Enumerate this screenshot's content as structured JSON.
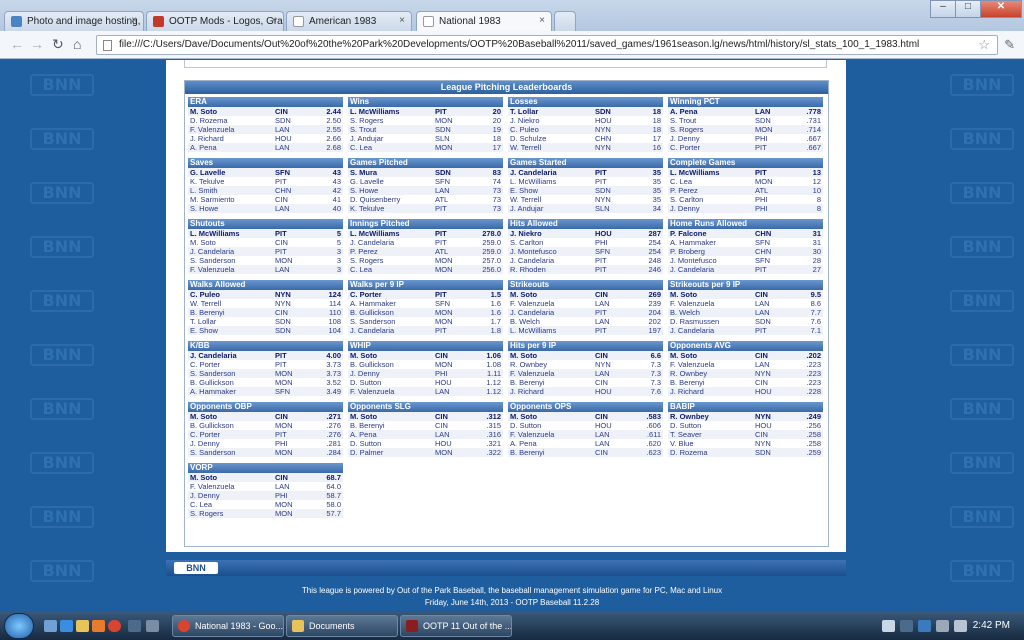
{
  "browser": {
    "tabs": [
      {
        "label": "Photo and image hosting,",
        "active": false
      },
      {
        "label": "OOTP Mods - Logos, Grap",
        "active": false
      },
      {
        "label": "American 1983",
        "active": false
      },
      {
        "label": "National 1983",
        "active": true
      }
    ],
    "url": "file:///C:/Users/Dave/Documents/Out%20of%20the%20Park%20Developments/OOTP%20Baseball%2011/saved_games/1961season.lg/news/html/history/sl_stats_100_1_1983.html",
    "back_icon": "back-arrow-icon",
    "forward_icon": "forward-arrow-icon",
    "reload_icon": "reload-icon",
    "home_icon": "home-icon"
  },
  "page": {
    "watermark_text": "BNN",
    "panel_title": "League Pitching Leaderboards",
    "categories": [
      {
        "title": "ERA",
        "rows": [
          [
            "M. Soto",
            "CIN",
            "2.44"
          ],
          [
            "D. Rozema",
            "SDN",
            "2.50"
          ],
          [
            "F. Valenzuela",
            "LAN",
            "2.55"
          ],
          [
            "J. Richard",
            "HOU",
            "2.66"
          ],
          [
            "A. Pena",
            "LAN",
            "2.68"
          ]
        ]
      },
      {
        "title": "Wins",
        "rows": [
          [
            "L. McWilliams",
            "PIT",
            "20"
          ],
          [
            "S. Rogers",
            "MON",
            "20"
          ],
          [
            "S. Trout",
            "SDN",
            "19"
          ],
          [
            "J. Andujar",
            "SLN",
            "18"
          ],
          [
            "C. Lea",
            "MON",
            "17"
          ]
        ]
      },
      {
        "title": "Losses",
        "rows": [
          [
            "T. Lollar",
            "SDN",
            "18"
          ],
          [
            "J. Niekro",
            "HOU",
            "18"
          ],
          [
            "C. Puleo",
            "NYN",
            "18"
          ],
          [
            "D. Schulze",
            "CHN",
            "17"
          ],
          [
            "W. Terrell",
            "NYN",
            "16"
          ]
        ]
      },
      {
        "title": "Winning PCT",
        "rows": [
          [
            "A. Pena",
            "LAN",
            ".778"
          ],
          [
            "S. Trout",
            "SDN",
            ".731"
          ],
          [
            "S. Rogers",
            "MON",
            ".714"
          ],
          [
            "J. Denny",
            "PHI",
            ".667"
          ],
          [
            "C. Porter",
            "PIT",
            ".667"
          ]
        ]
      },
      {
        "title": "Saves",
        "rows": [
          [
            "G. Lavelle",
            "SFN",
            "43"
          ],
          [
            "K. Tekulve",
            "PIT",
            "43"
          ],
          [
            "L. Smith",
            "CHN",
            "42"
          ],
          [
            "M. Sarmiento",
            "CIN",
            "41"
          ],
          [
            "S. Howe",
            "LAN",
            "40"
          ]
        ]
      },
      {
        "title": "Games Pitched",
        "rows": [
          [
            "S. Mura",
            "SDN",
            "83"
          ],
          [
            "G. Lavelle",
            "SFN",
            "74"
          ],
          [
            "S. Howe",
            "LAN",
            "73"
          ],
          [
            "D. Quisenberry",
            "ATL",
            "73"
          ],
          [
            "K. Tekulve",
            "PIT",
            "73"
          ]
        ]
      },
      {
        "title": "Games Started",
        "rows": [
          [
            "J. Candelaria",
            "PIT",
            "35"
          ],
          [
            "L. McWilliams",
            "PIT",
            "35"
          ],
          [
            "E. Show",
            "SDN",
            "35"
          ],
          [
            "W. Terrell",
            "NYN",
            "35"
          ],
          [
            "J. Andujar",
            "SLN",
            "34"
          ]
        ]
      },
      {
        "title": "Complete Games",
        "rows": [
          [
            "L. McWilliams",
            "PIT",
            "13"
          ],
          [
            "C. Lea",
            "MON",
            "12"
          ],
          [
            "P. Perez",
            "ATL",
            "10"
          ],
          [
            "S. Carlton",
            "PHI",
            "8"
          ],
          [
            "J. Denny",
            "PHI",
            "8"
          ]
        ]
      },
      {
        "title": "Shutouts",
        "rows": [
          [
            "L. McWilliams",
            "PIT",
            "5"
          ],
          [
            "M. Soto",
            "CIN",
            "5"
          ],
          [
            "J. Candelaria",
            "PIT",
            "3"
          ],
          [
            "S. Sanderson",
            "MON",
            "3"
          ],
          [
            "F. Valenzuela",
            "LAN",
            "3"
          ]
        ]
      },
      {
        "title": "Innings Pitched",
        "rows": [
          [
            "L. McWilliams",
            "PIT",
            "278.0"
          ],
          [
            "J. Candelaria",
            "PIT",
            "259.0"
          ],
          [
            "P. Perez",
            "ATL",
            "259.0"
          ],
          [
            "S. Rogers",
            "MON",
            "257.0"
          ],
          [
            "C. Lea",
            "MON",
            "256.0"
          ]
        ]
      },
      {
        "title": "Hits Allowed",
        "rows": [
          [
            "J. Niekro",
            "HOU",
            "287"
          ],
          [
            "S. Carlton",
            "PHI",
            "254"
          ],
          [
            "J. Montefusco",
            "SFN",
            "254"
          ],
          [
            "J. Candelaria",
            "PIT",
            "248"
          ],
          [
            "R. Rhoden",
            "PIT",
            "246"
          ]
        ]
      },
      {
        "title": "Home Runs Allowed",
        "rows": [
          [
            "P. Falcone",
            "CHN",
            "31"
          ],
          [
            "A. Hammaker",
            "SFN",
            "31"
          ],
          [
            "P. Broberg",
            "CHN",
            "30"
          ],
          [
            "J. Montefusco",
            "SFN",
            "28"
          ],
          [
            "J. Candelaria",
            "PIT",
            "27"
          ]
        ]
      },
      {
        "title": "Walks Allowed",
        "rows": [
          [
            "C. Puleo",
            "NYN",
            "124"
          ],
          [
            "W. Terrell",
            "NYN",
            "114"
          ],
          [
            "B. Berenyi",
            "CIN",
            "110"
          ],
          [
            "T. Lollar",
            "SDN",
            "108"
          ],
          [
            "E. Show",
            "SDN",
            "104"
          ]
        ]
      },
      {
        "title": "Walks per 9 IP",
        "rows": [
          [
            "C. Porter",
            "PIT",
            "1.5"
          ],
          [
            "A. Hammaker",
            "SFN",
            "1.6"
          ],
          [
            "B. Gullickson",
            "MON",
            "1.6"
          ],
          [
            "S. Sanderson",
            "MON",
            "1.7"
          ],
          [
            "J. Candelaria",
            "PIT",
            "1.8"
          ]
        ]
      },
      {
        "title": "Strikeouts",
        "rows": [
          [
            "M. Soto",
            "CIN",
            "269"
          ],
          [
            "F. Valenzuela",
            "LAN",
            "239"
          ],
          [
            "J. Candelaria",
            "PIT",
            "204"
          ],
          [
            "B. Welch",
            "LAN",
            "202"
          ],
          [
            "L. McWilliams",
            "PIT",
            "197"
          ]
        ]
      },
      {
        "title": "Strikeouts per 9 IP",
        "rows": [
          [
            "M. Soto",
            "CIN",
            "9.5"
          ],
          [
            "F. Valenzuela",
            "LAN",
            "8.6"
          ],
          [
            "B. Welch",
            "LAN",
            "7.7"
          ],
          [
            "D. Rasmussen",
            "SDN",
            "7.6"
          ],
          [
            "J. Candelaria",
            "PIT",
            "7.1"
          ]
        ]
      },
      {
        "title": "K/BB",
        "rows": [
          [
            "J. Candelaria",
            "PIT",
            "4.00"
          ],
          [
            "C. Porter",
            "PIT",
            "3.73"
          ],
          [
            "S. Sanderson",
            "MON",
            "3.73"
          ],
          [
            "B. Gullickson",
            "MON",
            "3.52"
          ],
          [
            "A. Hammaker",
            "SFN",
            "3.49"
          ]
        ]
      },
      {
        "title": "WHIP",
        "rows": [
          [
            "M. Soto",
            "CIN",
            "1.06"
          ],
          [
            "B. Gullickson",
            "MON",
            "1.08"
          ],
          [
            "J. Denny",
            "PHI",
            "1.11"
          ],
          [
            "D. Sutton",
            "HOU",
            "1.12"
          ],
          [
            "F. Valenzuela",
            "LAN",
            "1.12"
          ]
        ]
      },
      {
        "title": "Hits per 9 IP",
        "rows": [
          [
            "M. Soto",
            "CIN",
            "6.6"
          ],
          [
            "R. Ownbey",
            "NYN",
            "7.3"
          ],
          [
            "F. Valenzuela",
            "LAN",
            "7.3"
          ],
          [
            "B. Berenyi",
            "CIN",
            "7.3"
          ],
          [
            "J. Richard",
            "HOU",
            "7.6"
          ]
        ]
      },
      {
        "title": "Opponents AVG",
        "rows": [
          [
            "M. Soto",
            "CIN",
            ".202"
          ],
          [
            "F. Valenzuela",
            "LAN",
            ".223"
          ],
          [
            "R. Ownbey",
            "NYN",
            ".223"
          ],
          [
            "B. Berenyi",
            "CIN",
            ".223"
          ],
          [
            "J. Richard",
            "HOU",
            ".228"
          ]
        ]
      },
      {
        "title": "Opponents OBP",
        "rows": [
          [
            "M. Soto",
            "CIN",
            ".271"
          ],
          [
            "B. Gullickson",
            "MON",
            ".276"
          ],
          [
            "C. Porter",
            "PIT",
            ".276"
          ],
          [
            "J. Denny",
            "PHI",
            ".281"
          ],
          [
            "S. Sanderson",
            "MON",
            ".284"
          ]
        ]
      },
      {
        "title": "Opponents SLG",
        "rows": [
          [
            "M. Soto",
            "CIN",
            ".312"
          ],
          [
            "B. Berenyi",
            "CIN",
            ".315"
          ],
          [
            "A. Pena",
            "LAN",
            ".316"
          ],
          [
            "D. Sutton",
            "HOU",
            ".321"
          ],
          [
            "D. Palmer",
            "MON",
            ".322"
          ]
        ]
      },
      {
        "title": "Opponents OPS",
        "rows": [
          [
            "M. Soto",
            "CIN",
            ".583"
          ],
          [
            "D. Sutton",
            "HOU",
            ".606"
          ],
          [
            "F. Valenzuela",
            "LAN",
            ".611"
          ],
          [
            "A. Pena",
            "LAN",
            ".620"
          ],
          [
            "B. Berenyi",
            "CIN",
            ".623"
          ]
        ]
      },
      {
        "title": "BABIP",
        "rows": [
          [
            "R. Ownbey",
            "NYN",
            ".249"
          ],
          [
            "D. Sutton",
            "HOU",
            ".256"
          ],
          [
            "T. Seaver",
            "CIN",
            ".258"
          ],
          [
            "V. Blue",
            "NYN",
            ".258"
          ],
          [
            "D. Rozema",
            "SDN",
            ".259"
          ]
        ]
      },
      {
        "title": "VORP",
        "rows": [
          [
            "M. Soto",
            "CIN",
            "68.7"
          ],
          [
            "F. Valenzuela",
            "LAN",
            "64.0"
          ],
          [
            "J. Denny",
            "PHI",
            "58.7"
          ],
          [
            "C. Lea",
            "MON",
            "58.0"
          ],
          [
            "S. Rogers",
            "MON",
            "57.7"
          ]
        ]
      }
    ],
    "footer_logo": "BNN",
    "footer_line1": "This league is powered by Out of the Park Baseball, the baseball management simulation game for PC, Mac and Linux",
    "footer_line2": "Friday, June 14th, 2013 - OOTP Baseball 11.2.28"
  },
  "taskbar": {
    "tasks": [
      {
        "label": "National 1983 - Goo...",
        "icon_color": "#d9442f"
      },
      {
        "label": "Documents",
        "icon_color": "#e8c25a"
      },
      {
        "label": "OOTP 11 Out of the ...",
        "icon_color": "#8a1d1d"
      }
    ],
    "clock": "2:42 PM"
  }
}
